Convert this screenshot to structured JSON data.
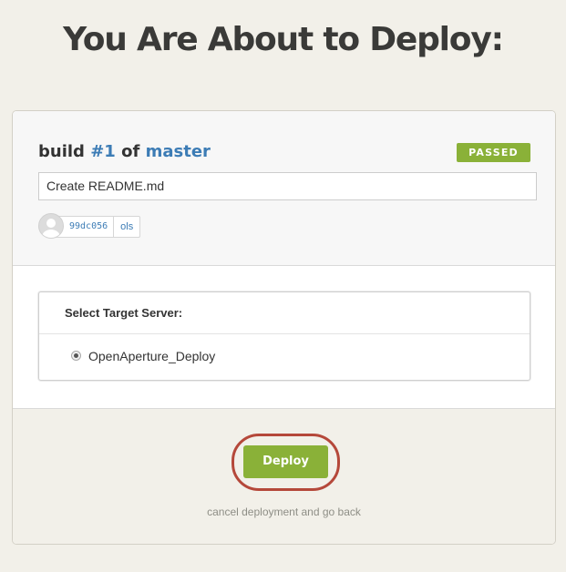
{
  "page": {
    "title": "You Are About to Deploy:"
  },
  "build": {
    "word_build": "build",
    "number": "#1",
    "word_of": "of",
    "branch": "master",
    "status": "PASSED",
    "commit_message": "Create README.md",
    "commit_sha": "99dc056",
    "commit_author": "ols",
    "avatar_icon": "user-silhouette-icon"
  },
  "target": {
    "header": "Select Target Server:",
    "servers": [
      {
        "label": "OpenAperture_Deploy",
        "selected": true
      }
    ]
  },
  "actions": {
    "deploy_label": "Deploy",
    "cancel_label": "cancel deployment and go back"
  },
  "colors": {
    "accent_green": "#8ab138",
    "link_blue": "#3c7cb5",
    "highlight_ring": "#b5483a",
    "page_background": "#f2f0e9"
  }
}
